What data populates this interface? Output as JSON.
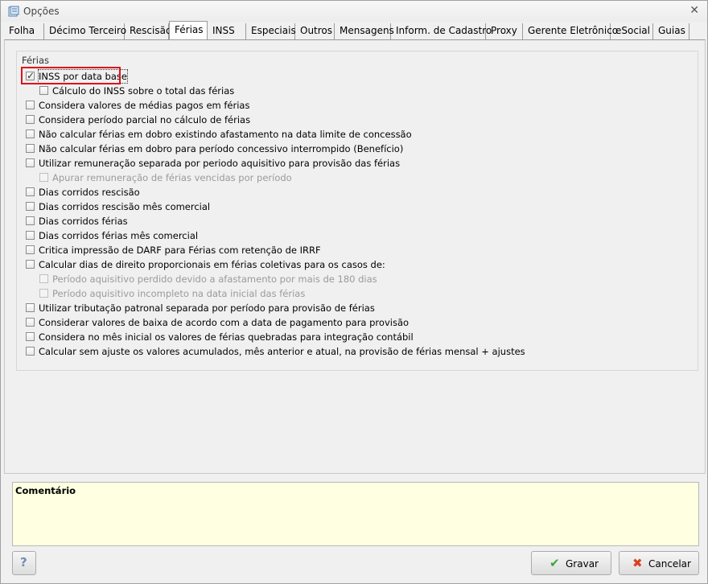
{
  "window": {
    "title": "Opções"
  },
  "tabs": [
    {
      "label": "Folha"
    },
    {
      "label": "Décimo Terceiro"
    },
    {
      "label": "Rescisão"
    },
    {
      "label": "Férias",
      "active": true
    },
    {
      "label": "INSS"
    },
    {
      "label": "Especiais"
    },
    {
      "label": "Outros"
    },
    {
      "label": "Mensagens"
    },
    {
      "label": "Inform. de Cadastro"
    },
    {
      "label": "Proxy"
    },
    {
      "label": "Gerente Eletrônico"
    },
    {
      "label": "eSocial"
    },
    {
      "label": "Guias"
    }
  ],
  "group": {
    "title": "Férias"
  },
  "options": [
    {
      "label": "INSS por data base",
      "checked": true,
      "enabled": true
    },
    {
      "label": "Cálculo do INSS sobre o  total das férias",
      "checked": false,
      "enabled": true
    },
    {
      "label": "Considera valores de médias pagos em férias",
      "checked": false,
      "enabled": true
    },
    {
      "label": "Considera período parcial no cálculo de férias",
      "checked": false,
      "enabled": true
    },
    {
      "label": "Não calcular férias em dobro existindo afastamento na data limite de concessão",
      "checked": false,
      "enabled": true
    },
    {
      "label": "Não calcular férias em dobro para período concessivo interrompido (Benefício)",
      "checked": false,
      "enabled": true
    },
    {
      "label": "Utilizar remuneração separada por periodo aquisitivo para provisão das férias",
      "checked": false,
      "enabled": true
    },
    {
      "label": "Apurar remuneração de férias vencidas por período",
      "checked": false,
      "enabled": false
    },
    {
      "label": "Dias corridos rescisão",
      "checked": false,
      "enabled": true
    },
    {
      "label": "Dias corridos rescisão mês comercial",
      "checked": false,
      "enabled": true
    },
    {
      "label": "Dias corridos férias",
      "checked": false,
      "enabled": true
    },
    {
      "label": "Dias corridos férias mês comercial",
      "checked": false,
      "enabled": true
    },
    {
      "label": "Critica impressão de DARF para Férias com retenção de IRRF",
      "checked": false,
      "enabled": true
    },
    {
      "label": "Calcular dias de direito proporcionais em férias coletivas para os casos de:",
      "checked": false,
      "enabled": true
    },
    {
      "label": "Período aquisitivo perdido devido a afastamento por mais de 180 dias",
      "checked": false,
      "enabled": false
    },
    {
      "label": "Período aquisitivo incompleto na data inicial das férias",
      "checked": false,
      "enabled": false
    },
    {
      "label": "Utilizar tributação patronal separada por período para provisão de férias",
      "checked": false,
      "enabled": true
    },
    {
      "label": "Considerar valores de baixa de acordo com a data de pagamento para provisão",
      "checked": false,
      "enabled": true
    },
    {
      "label": "Considera no mês inicial os valores de férias quebradas para integração contábil",
      "checked": false,
      "enabled": true
    },
    {
      "label": " Calcular sem ajuste os valores acumulados, mês anterior e atual, na provisão de férias mensal + ajustes",
      "checked": false,
      "enabled": true
    }
  ],
  "comment": {
    "title": "Comentário"
  },
  "buttons": {
    "help": "?",
    "save": "Gravar",
    "cancel": "Cancelar"
  },
  "colors": {
    "highlight": "#e0121b",
    "comment_bg": "#ffffe1",
    "save_icon": "#3aa53a",
    "cancel_icon": "#d9411e"
  },
  "icons": {
    "window": "options-window-icon",
    "close": "close-icon",
    "save": "check-icon",
    "cancel": "x-icon",
    "help": "help-icon"
  }
}
